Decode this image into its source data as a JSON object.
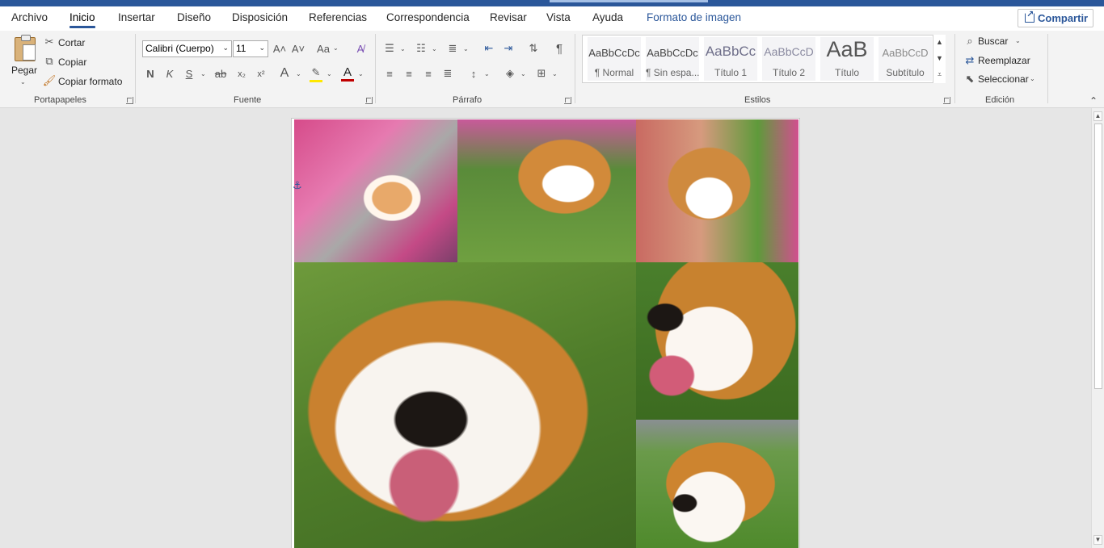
{
  "tabs": {
    "archivo": "Archivo",
    "inicio": "Inicio",
    "insertar": "Insertar",
    "diseno": "Diseño",
    "disposicion": "Disposición",
    "referencias": "Referencias",
    "correspondencia": "Correspondencia",
    "revisar": "Revisar",
    "vista": "Vista",
    "ayuda": "Ayuda",
    "formato_imagen": "Formato de imagen"
  },
  "share_label": "Compartir",
  "clipboard": {
    "paste": "Pegar",
    "cut": "Cortar",
    "copy": "Copiar",
    "format_painter": "Copiar formato",
    "group": "Portapapeles"
  },
  "font": {
    "name": "Calibri (Cuerpo)",
    "size": "11",
    "group": "Fuente",
    "bold": "N",
    "italic": "K",
    "underline": "S",
    "strike": "ab",
    "grow": "A˄",
    "shrink": "A˅",
    "case": "Aa",
    "effects": "A",
    "color_letter": "A",
    "font_color": "#c00000",
    "highlight_color": "#ffe800"
  },
  "paragraph": {
    "group": "Párrafo"
  },
  "styles": {
    "group": "Estilos",
    "items": [
      {
        "preview": "AaBbCcDc",
        "name": "¶ Normal"
      },
      {
        "preview": "AaBbCcDc",
        "name": "¶ Sin espa..."
      },
      {
        "preview": "AaBbCc",
        "name": "Título 1"
      },
      {
        "preview": "AaBbCcD",
        "name": "Título 2"
      },
      {
        "preview": "AaB",
        "name": "Título"
      },
      {
        "preview": "AaBbCcD",
        "name": "Subtítulo"
      }
    ]
  },
  "editing": {
    "group": "Edición",
    "find": "Buscar",
    "replace": "Reemplazar",
    "select": "Seleccionar"
  },
  "colors": {
    "accent": "#2b579a",
    "ribbon_bg": "#f3f3f3",
    "canvas_bg": "#e6e6e6"
  },
  "document": {
    "photos": [
      "corgi-photo-1",
      "corgi-photo-2",
      "corgi-photo-3",
      "corgi-photo-4",
      "corgi-photo-5",
      "corgi-photo-6"
    ]
  }
}
